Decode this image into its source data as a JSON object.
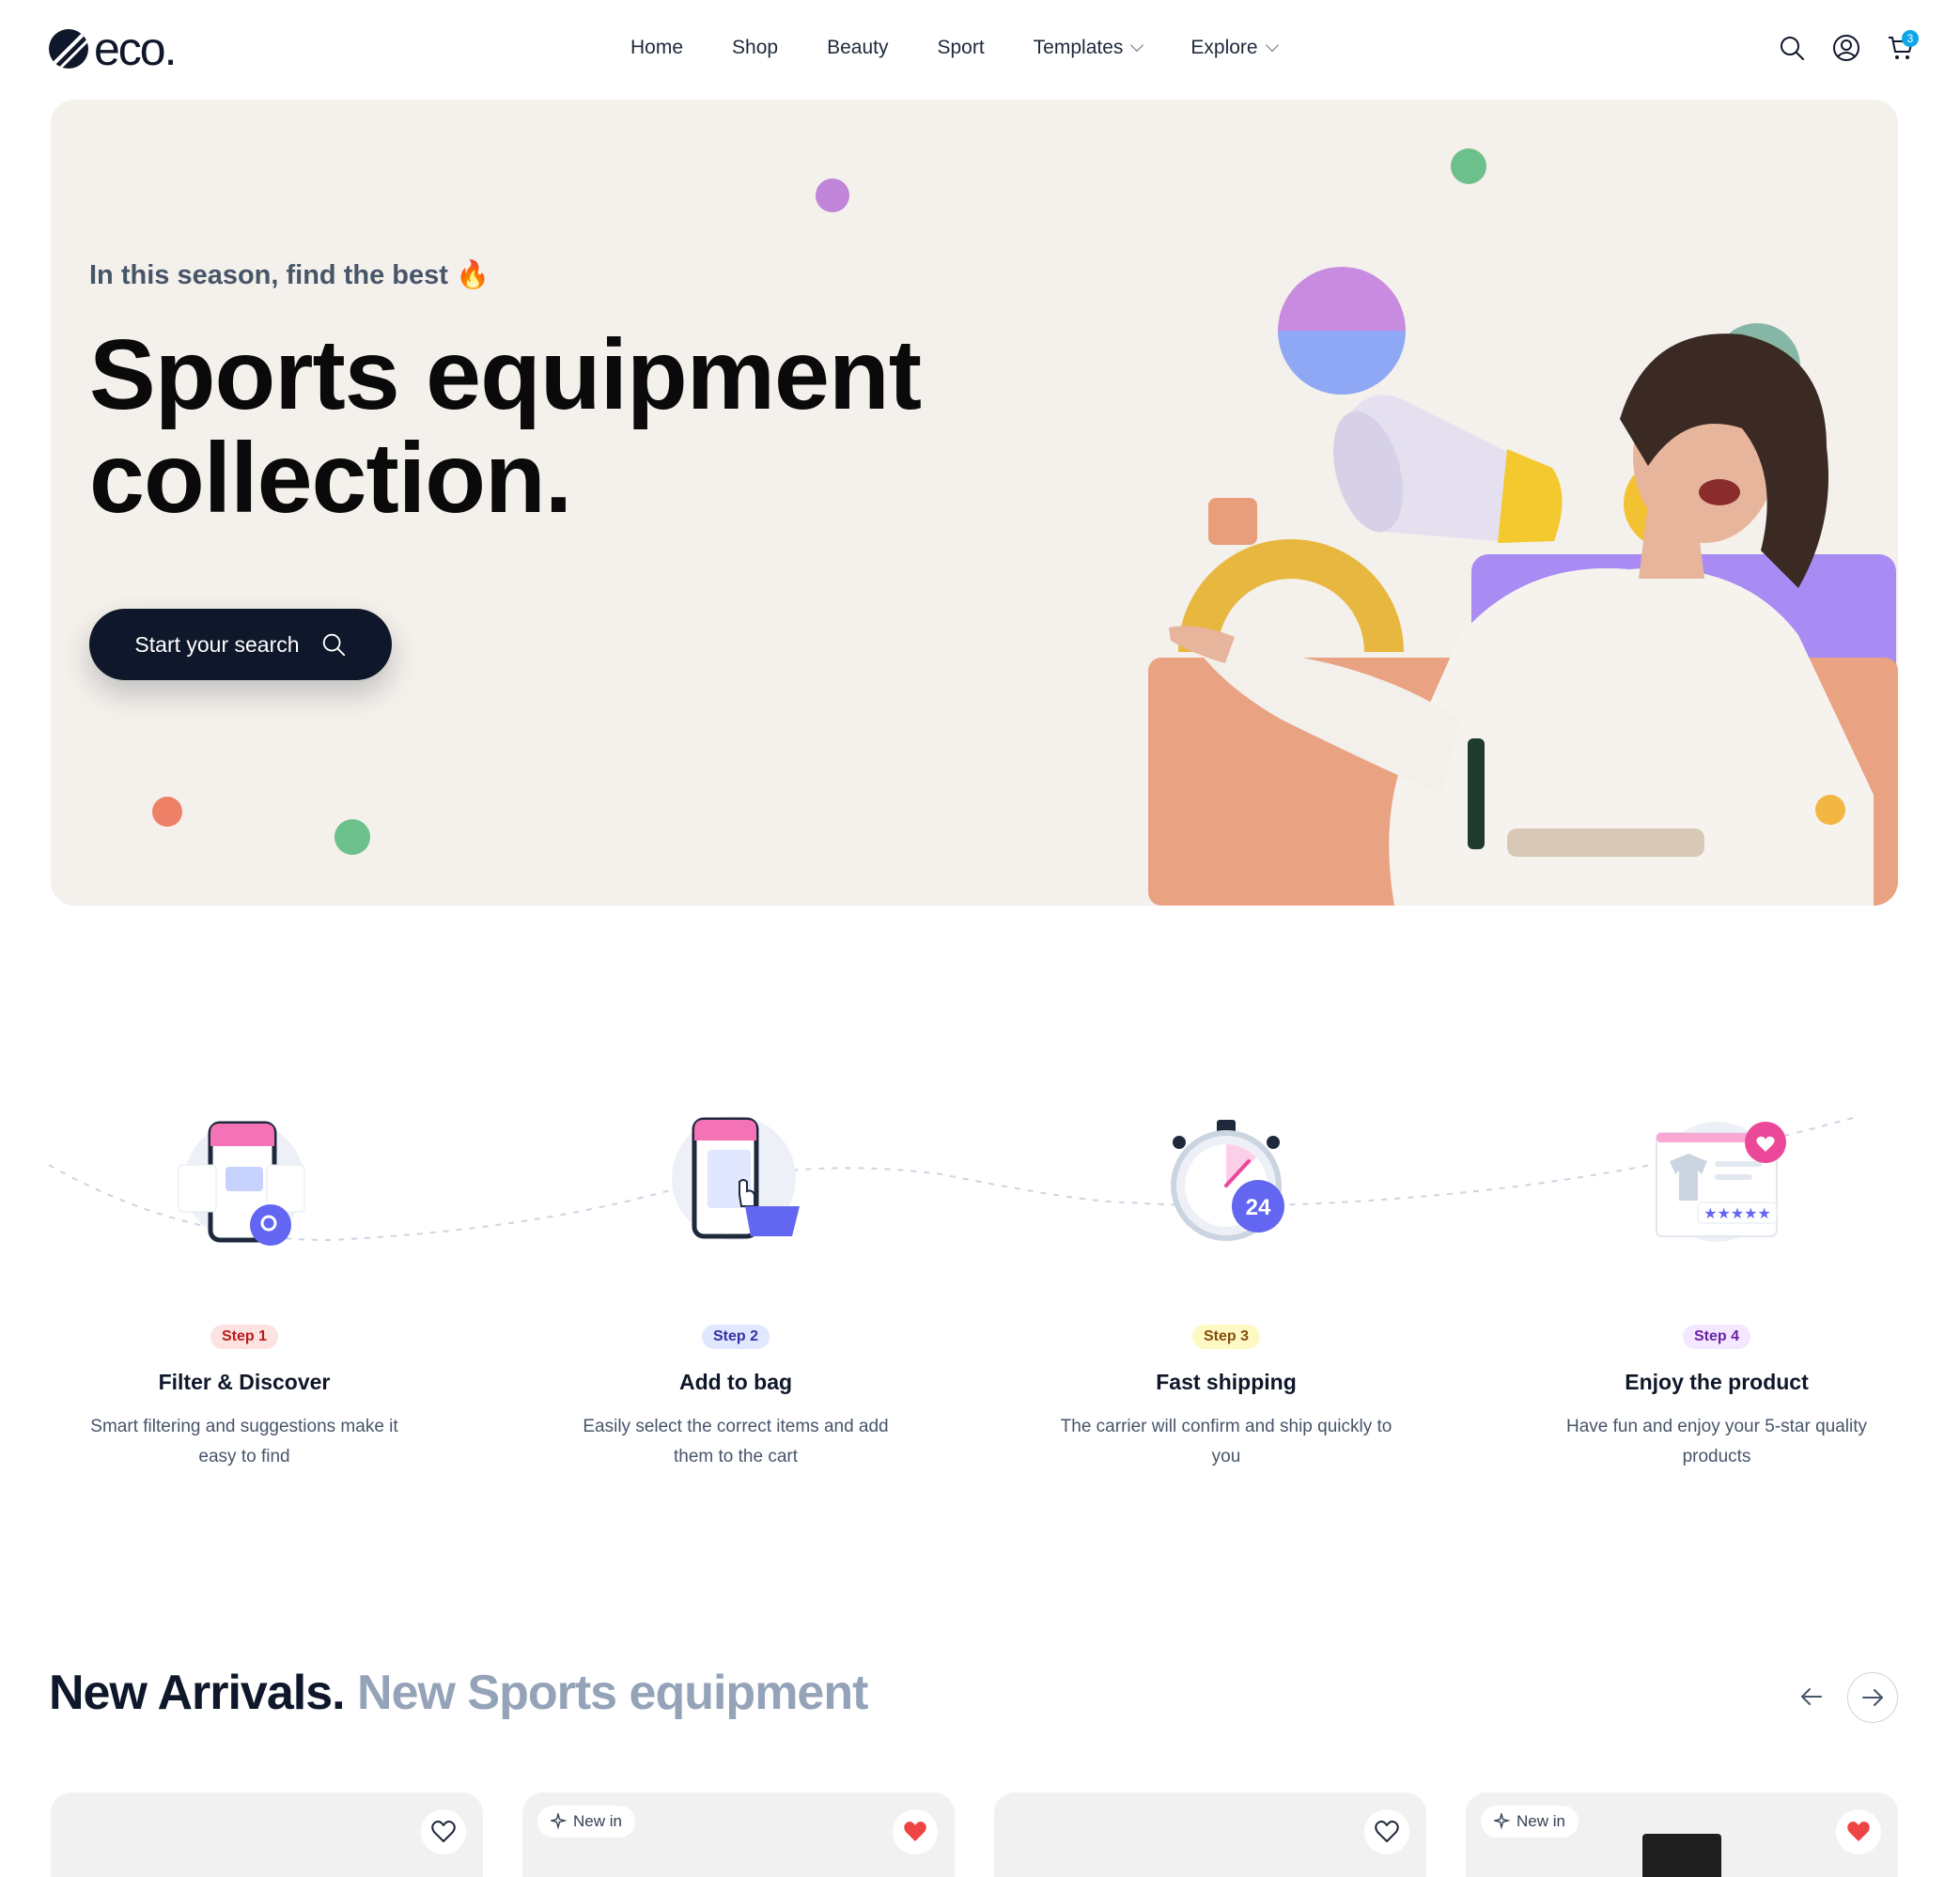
{
  "header": {
    "logo_text": "eco.",
    "nav": [
      {
        "label": "Home",
        "dropdown": false
      },
      {
        "label": "Shop",
        "dropdown": false
      },
      {
        "label": "Beauty",
        "dropdown": false
      },
      {
        "label": "Sport",
        "dropdown": false
      },
      {
        "label": "Templates",
        "dropdown": true
      },
      {
        "label": "Explore",
        "dropdown": true
      }
    ],
    "icons": [
      "search-icon",
      "account-icon",
      "cart-icon"
    ],
    "cart_count": "3"
  },
  "hero": {
    "subtitle": "In this season, find the best 🔥",
    "title_line1": "Sports equipment",
    "title_line2": "collection.",
    "cta_label": "Start your search",
    "background": "#f4f0eb"
  },
  "steps": [
    {
      "badge": "Step 1",
      "title": "Filter & Discover",
      "desc_line1": "Smart filtering and suggestions make it",
      "desc_line2": "easy to find",
      "badge_bg": "#fee2e2",
      "badge_color": "#b91c1c"
    },
    {
      "badge": "Step 2",
      "title": "Add to bag",
      "desc_line1": "Easily select the correct items and add",
      "desc_line2": "them to the cart",
      "badge_bg": "#e0e7ff",
      "badge_color": "#3730a3"
    },
    {
      "badge": "Step 3",
      "title": "Fast shipping",
      "desc_line1": "The carrier will confirm and ship quickly to",
      "desc_line2": "you",
      "badge_bg": "#fef9c3",
      "badge_color": "#854d0e"
    },
    {
      "badge": "Step 4",
      "title": "Enjoy the product",
      "desc_line1": "Have fun and enjoy your 5-star quality",
      "desc_line2": "products",
      "badge_bg": "#f3e8ff",
      "badge_color": "#6b21a8"
    }
  ],
  "new_arrivals": {
    "title_bold": "New Arrivals.",
    "title_muted": "New Sports equipment",
    "cards": [
      {
        "badge": "",
        "liked": false
      },
      {
        "badge": "New in",
        "liked": true
      },
      {
        "badge": "",
        "liked": false
      },
      {
        "badge": "New in",
        "liked": true
      }
    ]
  },
  "colors": {
    "primary": "#0f172a",
    "accent_heart": "#ef4444",
    "muted": "#94a3b8"
  }
}
